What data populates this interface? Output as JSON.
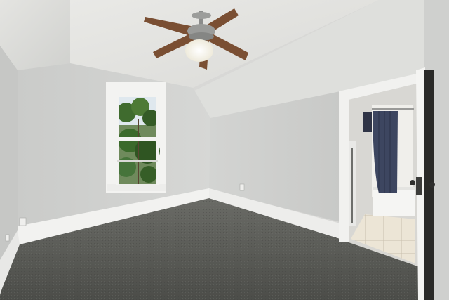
{
  "scene": {
    "subject": "empty-attic-bedroom",
    "colors": {
      "ceiling": "#e6e6e3",
      "slope_wall": "#dcdcd9",
      "left_wall": "#c9cac9",
      "back_wall": "#cfd0ce",
      "right_wall": "#d4d5d3",
      "carpet": "#5a5b57",
      "trim": "#f4f4f2",
      "fan_blade": "#7a4f33",
      "fan_light": "#f7f5ec",
      "curtain": "#3d4660",
      "tile": "#e9e2d3",
      "tree_green": "#3f6b2e"
    },
    "elements": [
      {
        "name": "ceiling-fan",
        "blades": 5,
        "light": "on"
      },
      {
        "name": "window",
        "panes": 2,
        "view": "trees"
      },
      {
        "name": "bathroom-doorway",
        "door": "open"
      },
      {
        "name": "shower-curtain",
        "color": "navy"
      },
      {
        "name": "bathtub"
      },
      {
        "name": "carpet-floor"
      },
      {
        "name": "baseboard"
      },
      {
        "name": "electrical-outlet",
        "count": 2
      }
    ]
  }
}
